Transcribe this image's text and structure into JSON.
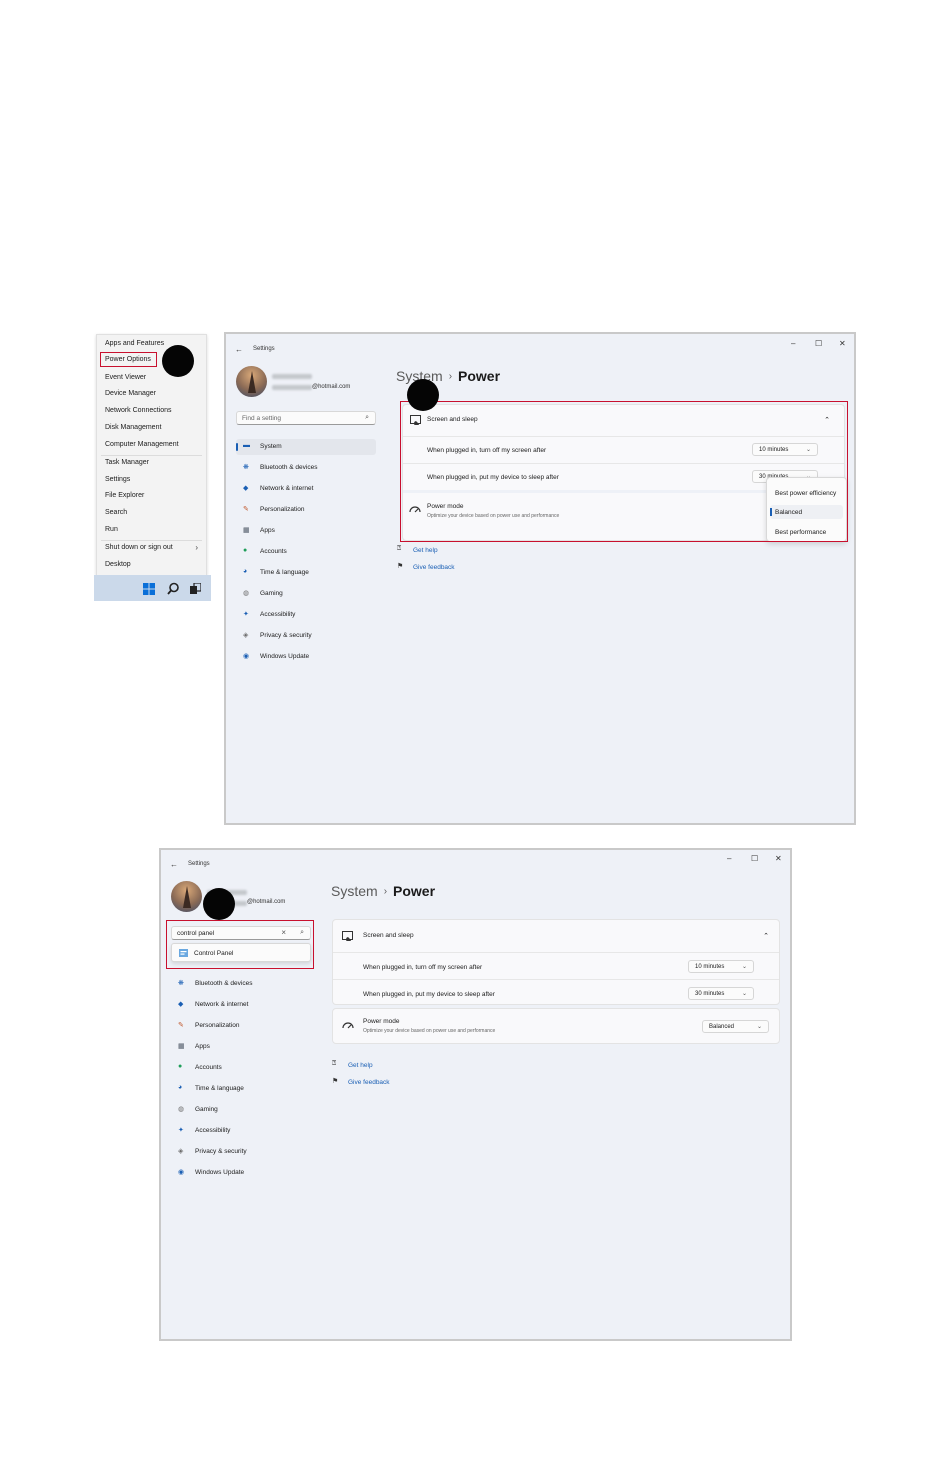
{
  "winx_menu": {
    "items": [
      {
        "label": "Apps and Features"
      },
      {
        "label": "Power Options"
      },
      {
        "label": "Event Viewer"
      },
      {
        "label": "Device Manager"
      },
      {
        "label": "Network Connections"
      },
      {
        "label": "Disk Management"
      },
      {
        "label": "Computer Management"
      },
      {
        "label": "Task Manager"
      },
      {
        "label": "Settings"
      },
      {
        "label": "File Explorer"
      },
      {
        "label": "Search"
      },
      {
        "label": "Run"
      },
      {
        "label": "Shut down or sign out",
        "arrow": "›"
      },
      {
        "label": "Desktop"
      }
    ]
  },
  "taskbar": {
    "icons": [
      "windows-logo-icon",
      "search-icon",
      "task-view-icon"
    ]
  },
  "window1": {
    "title": "Settings",
    "back": "←",
    "controls": {
      "minimize": "–",
      "maximize": "☐",
      "close": "✕"
    },
    "email": "@hotmail.com",
    "search_placeholder": "Find a setting",
    "search_icon": "⌕",
    "breadcrumb": {
      "parent": "System",
      "sep": "›",
      "current": "Power"
    },
    "screen_sleep": {
      "title": "Screen and sleep",
      "chevron": "⌃",
      "rows": [
        {
          "label": "When plugged in, turn off my screen after",
          "value": "10 minutes"
        },
        {
          "label": "When plugged in, put my device to sleep after",
          "value": "30 minutes"
        }
      ]
    },
    "power_mode": {
      "title": "Power mode",
      "subtitle": "Optimize your device based on power use and performance"
    },
    "flyout_options": [
      "Best power efficiency",
      "Balanced",
      "Best performance"
    ],
    "links": {
      "help": "Get help",
      "feedback": "Give feedback"
    }
  },
  "window2": {
    "title": "Settings",
    "back": "←",
    "controls": {
      "minimize": "–",
      "maximize": "☐",
      "close": "✕"
    },
    "email": "@hotmail.com",
    "search_value": "control panel",
    "clear_icon": "×",
    "search_icon": "⌕",
    "suggestion": "Control Panel",
    "breadcrumb": {
      "parent": "System",
      "sep": "›",
      "current": "Power"
    },
    "screen_sleep": {
      "title": "Screen and sleep",
      "chevron": "⌃",
      "rows": [
        {
          "label": "When plugged in, turn off my screen after",
          "value": "10 minutes"
        },
        {
          "label": "When plugged in, put my device to sleep after",
          "value": "30 minutes"
        }
      ]
    },
    "power_mode": {
      "title": "Power mode",
      "subtitle": "Optimize your device based on power use and performance",
      "value": "Balanced"
    },
    "links": {
      "help": "Get help",
      "feedback": "Give feedback"
    }
  },
  "nav": {
    "items": [
      {
        "label": "System",
        "icon": "▬",
        "color": "#1a5fb4"
      },
      {
        "label": "Bluetooth & devices",
        "icon": "❋",
        "color": "#1a5fb4"
      },
      {
        "label": "Network & internet",
        "icon": "◆",
        "color": "#1a5fb4"
      },
      {
        "label": "Personalization",
        "icon": "✎",
        "color": "#c0562a"
      },
      {
        "label": "Apps",
        "icon": "▦",
        "color": "#4a5563"
      },
      {
        "label": "Accounts",
        "icon": "●",
        "color": "#1f9e5a"
      },
      {
        "label": "Time & language",
        "icon": "◕",
        "color": "#1a5fb4"
      },
      {
        "label": "Gaming",
        "icon": "◍",
        "color": "#6b6b6b"
      },
      {
        "label": "Accessibility",
        "icon": "✦",
        "color": "#1a5fb4"
      },
      {
        "label": "Privacy & security",
        "icon": "◈",
        "color": "#6b6b6b"
      },
      {
        "label": "Windows Update",
        "icon": "◉",
        "color": "#1a5fb4"
      }
    ]
  },
  "accent": "#1a5fb4",
  "highlight": "#c8102e"
}
